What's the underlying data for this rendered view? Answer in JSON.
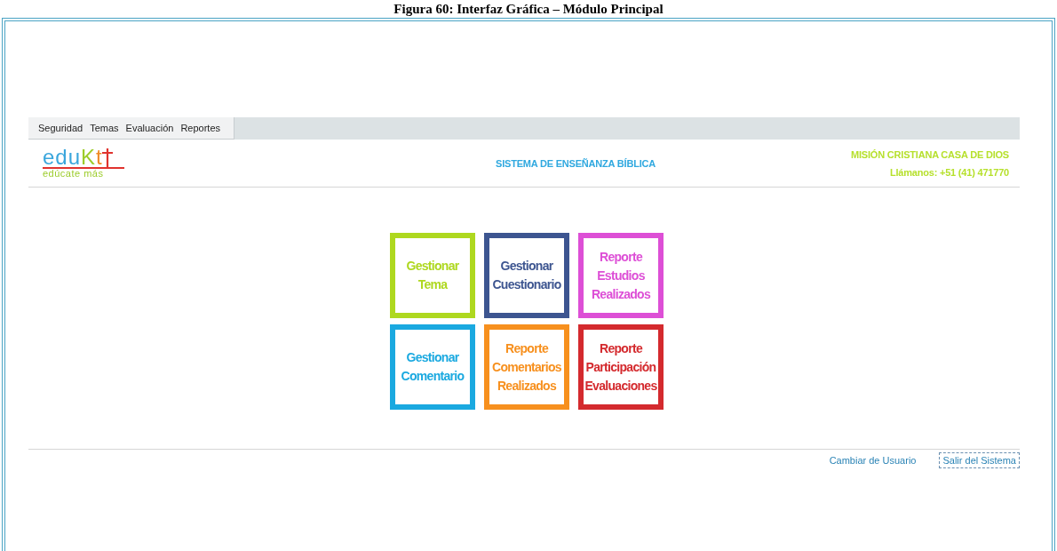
{
  "caption": "Figura 60: Interfaz Gráfica – Módulo Principal",
  "menu_bar": {
    "items": [
      {
        "label": "Seguridad"
      },
      {
        "label": "Temas"
      },
      {
        "label": "Evaluación"
      },
      {
        "label": "Reportes"
      }
    ]
  },
  "header": {
    "logo": {
      "parts": [
        {
          "text": "edu",
          "color": "#3aa6dc"
        },
        {
          "text": "K",
          "color": "#9ccc2a"
        },
        {
          "text": "t",
          "color": "#f08a24"
        }
      ],
      "tagline": "edúcate más"
    },
    "title": "SISTEMA DE ENSEÑANZA BÍBLICA",
    "organization": "MISIÓN CRISTIANA CASA DE DIOS",
    "phone": "Llámanos: +51 (41) 471770"
  },
  "tiles": [
    {
      "label": "Gestionar Tema",
      "color": "#aed81f"
    },
    {
      "label": "Gestionar Cuestionario",
      "color": "#3d5590"
    },
    {
      "label": "Reporte Estudios Realizados",
      "color": "#dd4fd6"
    },
    {
      "label": "Gestionar Comentario",
      "color": "#1aa9e0"
    },
    {
      "label": "Reporte Comentarios Realizados",
      "color": "#f7901e"
    },
    {
      "label": "Reporte Participación Evaluaciones",
      "color": "#d42a2e"
    }
  ],
  "footer_links": [
    {
      "label": "Cambiar de Usuario",
      "focused": false
    },
    {
      "label": "Salir del Sistema",
      "focused": true
    }
  ]
}
